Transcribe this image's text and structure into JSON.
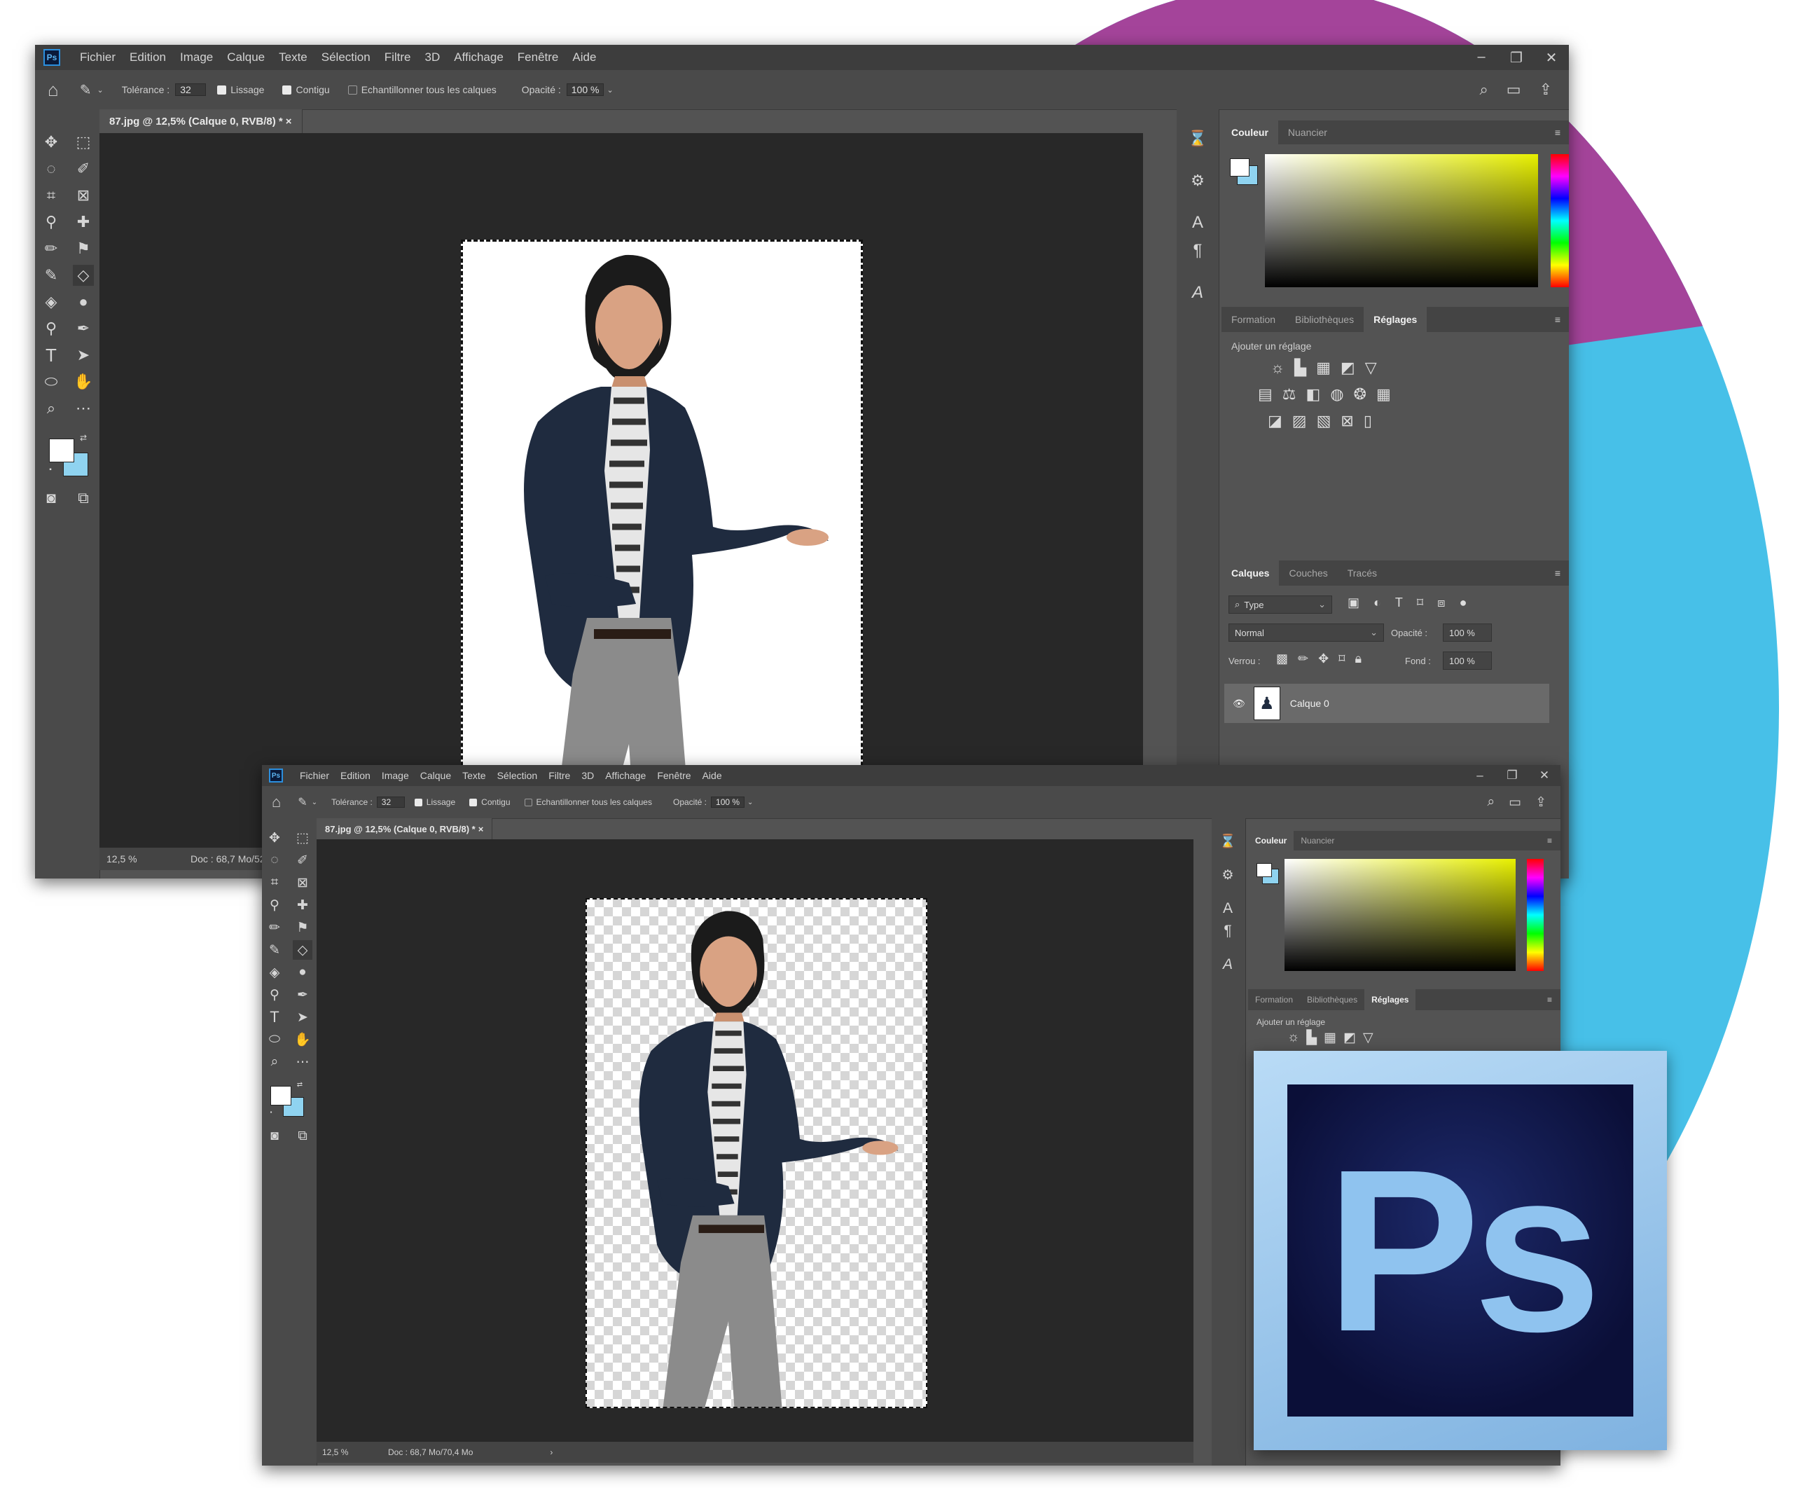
{
  "menu": [
    "Fichier",
    "Edition",
    "Image",
    "Calque",
    "Texte",
    "Sélection",
    "Filtre",
    "3D",
    "Affichage",
    "Fenêtre",
    "Aide"
  ],
  "app_icon": "Ps",
  "options": {
    "tolerance_label": "Tolérance :",
    "tolerance_value": "32",
    "lissage": "Lissage",
    "contigu": "Contigu",
    "echantillonner": "Echantillonner tous les calques",
    "opacite_label": "Opacité :",
    "opacite_value": "100 %"
  },
  "document_tab": "87.jpg @ 12,5% (Calque 0, RVB/8) *",
  "tab_close": "×",
  "status": {
    "zoom": "12,5 %",
    "doc_top": "Doc : 68,7 Mo/52",
    "doc_bottom": "Doc : 68,7 Mo/70,4 Mo",
    "arrow": "›"
  },
  "color_panel": {
    "tabs": [
      "Couleur",
      "Nuancier"
    ]
  },
  "adjust_panel": {
    "tabs": [
      "Formation",
      "Bibliothèques",
      "Réglages"
    ],
    "add_label": "Ajouter un réglage"
  },
  "layers_panel": {
    "tabs": [
      "Calques",
      "Couches",
      "Tracés"
    ],
    "filter": "Type",
    "blend_mode": "Normal",
    "opacity_label": "Opacité :",
    "opacity_value": "100 %",
    "lock_label": "Verrou :",
    "fill_label": "Fond :",
    "fill_value": "100 %",
    "layer_name": "Calque 0"
  },
  "logo_text": "Ps",
  "colors": {
    "accent_blue": "#47c0e8",
    "accent_purple": "#a4449a",
    "ps_dark": "#0b0f38",
    "ps_light": "#8fc3ef"
  }
}
